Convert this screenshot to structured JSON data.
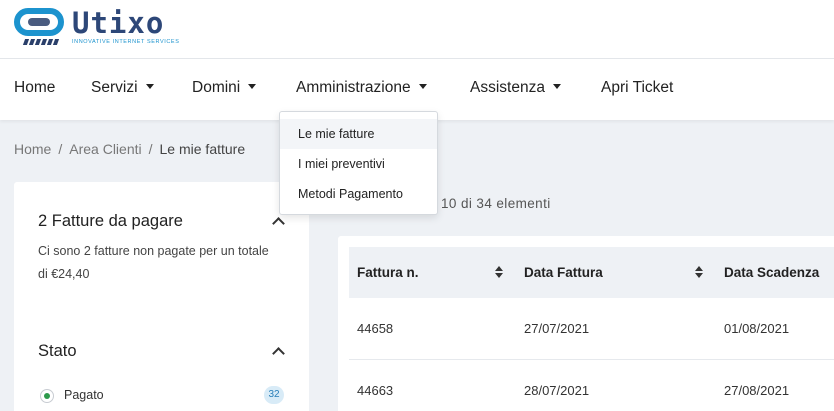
{
  "brand": {
    "name": "Utixo",
    "tagline": "INNOVATIVE INTERNET SERVICES",
    "primary_color": "#1c93ce",
    "secondary_color": "#2d4778"
  },
  "nav": {
    "home": "Home",
    "servizi": "Servizi",
    "domini": "Domini",
    "amministrazione": "Amministrazione",
    "assistenza": "Assistenza",
    "apri_ticket": "Apri Ticket"
  },
  "dropdown": {
    "items": [
      "Le mie fatture",
      "I miei preventivi",
      "Metodi Pagamento"
    ]
  },
  "breadcrumb": {
    "home": "Home",
    "area": "Area Clienti",
    "current": "Le mie fatture",
    "separator": "/"
  },
  "sidebar": {
    "unpaid_title": "2 Fatture da pagare",
    "unpaid_text": "Ci sono 2 fatture non pagate per un totale di €24,40",
    "status_title": "Stato",
    "status_items": [
      {
        "label": "Pagato",
        "count": "32"
      }
    ]
  },
  "table": {
    "count_info": "10 di 34 elementi",
    "headers": [
      "Fattura n.",
      "Data Fattura",
      "Data Scadenza"
    ],
    "rows": [
      [
        "44658",
        "27/07/2021",
        "01/08/2021"
      ],
      [
        "44663",
        "28/07/2021",
        "27/08/2021"
      ]
    ]
  }
}
